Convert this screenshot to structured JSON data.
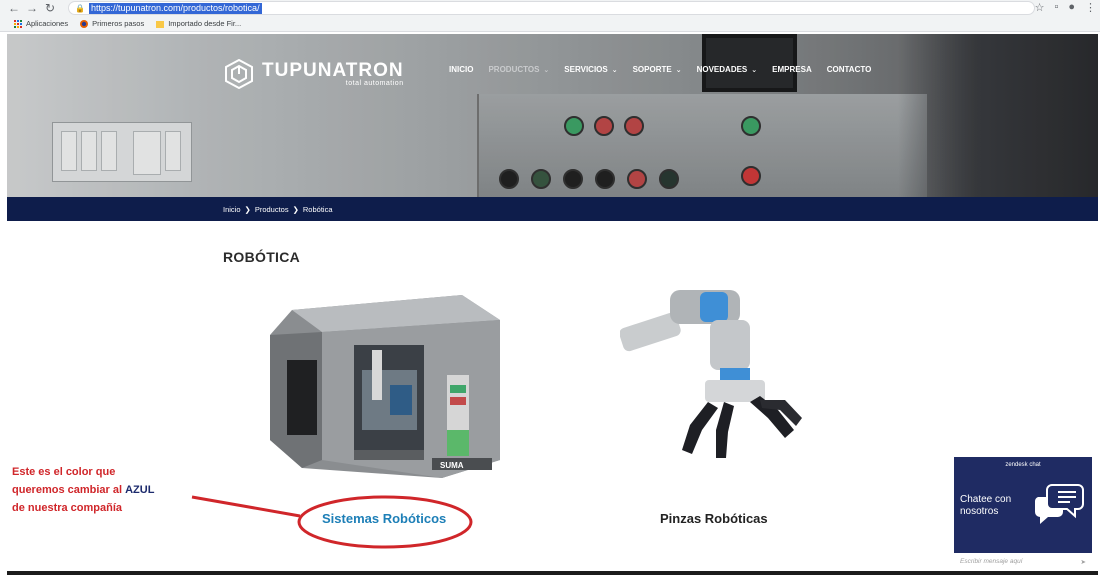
{
  "browser": {
    "url": "https://tupunatron.com/productos/robotica/",
    "bookmarks": [
      "Aplicaciones",
      "Primeros pasos",
      "Importado desde Fir..."
    ]
  },
  "header": {
    "brand": "TUPUNATRON",
    "tagline": "total automation",
    "menu": [
      {
        "label": "INICIO",
        "caret": false,
        "active": false
      },
      {
        "label": "PRODUCTOS",
        "caret": true,
        "active": true
      },
      {
        "label": "SERVICIOS",
        "caret": true,
        "active": false
      },
      {
        "label": "SOPORTE",
        "caret": true,
        "active": false
      },
      {
        "label": "NOVEDADES",
        "caret": true,
        "active": false
      },
      {
        "label": "EMPRESA",
        "caret": false,
        "active": false
      },
      {
        "label": "CONTACTO",
        "caret": false,
        "active": false
      }
    ]
  },
  "breadcrumb": [
    "Inicio",
    "Productos",
    "Robótica"
  ],
  "page": {
    "title": "ROBÓTICA",
    "products": [
      {
        "label": "Sistemas Robóticos",
        "color": "#1d7fb7"
      },
      {
        "label": "Pinzas Robóticas",
        "color": "#222222"
      }
    ]
  },
  "annotation": {
    "line1": "Este es el color que",
    "line2_pre": "queremos cambiar al ",
    "line2_em": "AZUL",
    "line3": "de nuestra compañía"
  },
  "chat": {
    "title": "zendesk chat",
    "text1": "Chatee con",
    "text2": "nosotros",
    "placeholder": "Escribir mensaje aquí"
  },
  "colors": {
    "nav_dark": "#0e1d4b",
    "chat_bg": "#1f2b63",
    "annotation_red": "#d0262a"
  }
}
